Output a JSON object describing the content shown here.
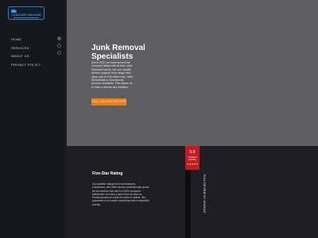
{
  "brand": {
    "logo_text": "CONCORD HAULING"
  },
  "nav": {
    "items": [
      {
        "label": "HOME"
      },
      {
        "label": "SERVICES"
      },
      {
        "label": "ABOUT US"
      },
      {
        "label": "PRIVACY POLICY"
      }
    ]
  },
  "pager": {
    "count": 3,
    "active_index": 0
  },
  "hero": {
    "title": "Junk Removal Specialists",
    "text": "Since 2007 we have served the Concord Valley with all their Junk Removal needs. We can handle all size projects from single item clean-ups to Full entire haul. With Residential & Commercial services available. This allows us to help in almost any situation.",
    "cta_label": "CALL US (925) 667-5070"
  },
  "rating_section": {
    "title": "Five-Star Rating",
    "text": "Our positive ratings from homeowners, businesses, and other service professionals speak for themselves! We aim for 100% customer satisfaction on every project that we take on. Professionalism is what we strive to deliver. We guarantee a no-hassle experience with competitive pricing."
  },
  "rating_widget": {
    "score": "5.0",
    "caption": "GOOGLE RATING",
    "stars": "★★★★★",
    "side_label": "FULL REVIEW BY GOOGLE",
    "colors": {
      "background": "#c31b22",
      "stars": "#ffd34d"
    }
  },
  "colors": {
    "sidebar": "#15181d",
    "hero_overlay": "#5e5e62",
    "cta": "#ef7d12",
    "section_bg": "#1e1e24"
  }
}
